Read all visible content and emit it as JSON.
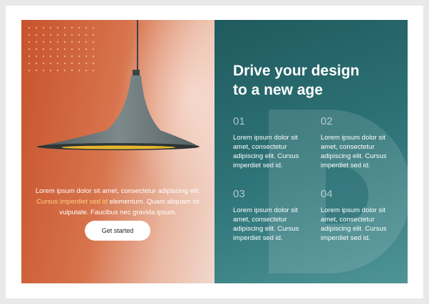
{
  "left": {
    "text_before": "Lorem ipsum dolor sit amet, consectetur adipiscing elit. ",
    "text_highlight": "Cursus imperdiet sed id",
    "text_after": " elementum. Quam aliquam sit vulputate. Faucibus nec gravida ipsum.",
    "button_label": "Get started"
  },
  "right": {
    "title_line1": "Drive your design",
    "title_line2": "to a new age",
    "features": [
      {
        "num": "01",
        "text": "Lorem ipsum dolor sit amet, consectetur adipiscing elit. Cursus imperdiet sed id."
      },
      {
        "num": "02",
        "text": "Lorem ipsum dolor sit amet, consectetur adipiscing elit. Cursus imperdiet sed id."
      },
      {
        "num": "03",
        "text": "Lorem ipsum dolor sit amet, consectetur adipiscing elit. Cursus imperdiet sed id."
      },
      {
        "num": "04",
        "text": "Lorem ipsum dolor sit amet, consectetur adipiscing elit. Cursus imperdiet sed id."
      }
    ]
  },
  "colors": {
    "left_accent": "#c7532c",
    "right_accent": "#2f7579",
    "highlight": "#ffd37a"
  }
}
